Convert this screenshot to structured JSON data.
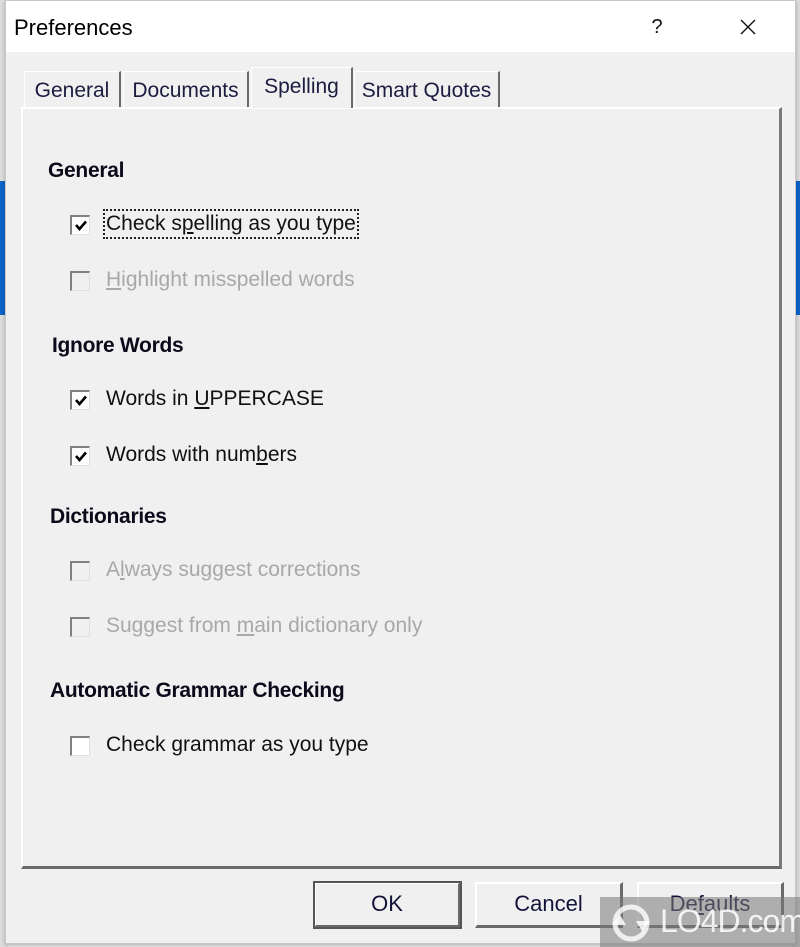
{
  "window": {
    "title": "Preferences",
    "help_label": "?",
    "close_icon": "close-icon"
  },
  "tabs": [
    {
      "label": "General",
      "active": false
    },
    {
      "label": "Documents",
      "active": false
    },
    {
      "label": "Spelling",
      "active": true
    },
    {
      "label": "Smart Quotes",
      "active": false
    }
  ],
  "sections": {
    "general": {
      "title": "General",
      "options": [
        {
          "label_pre": "Check s",
          "mnemonic": "p",
          "label_post": "elling as you type",
          "checked": true,
          "enabled": true,
          "focused": true
        },
        {
          "label_pre": "",
          "mnemonic": "H",
          "label_post": "ighlight misspelled words",
          "checked": false,
          "enabled": false
        }
      ]
    },
    "ignore_words": {
      "title": "Ignore Words",
      "options": [
        {
          "label_pre": "Words in ",
          "mnemonic": "U",
          "label_post": "PPERCASE",
          "checked": true,
          "enabled": true
        },
        {
          "label_pre": "Words with num",
          "mnemonic": "b",
          "label_post": "ers",
          "checked": true,
          "enabled": true
        }
      ]
    },
    "dictionaries": {
      "title": "Dictionaries",
      "options": [
        {
          "label_pre": "A",
          "mnemonic": "l",
          "label_post": "ways suggest corrections",
          "checked": false,
          "enabled": false
        },
        {
          "label_pre": "Suggest from ",
          "mnemonic": "m",
          "label_post": "ain dictionary only",
          "checked": false,
          "enabled": false
        }
      ]
    },
    "grammar": {
      "title": "Automatic Grammar Checking",
      "options": [
        {
          "label_pre": "Check ",
          "mnemonic": "g",
          "label_post": "rammar as you type",
          "checked": false,
          "enabled": true
        }
      ]
    }
  },
  "buttons": {
    "ok": "OK",
    "cancel": "Cancel",
    "defaults_pre": "De",
    "defaults_mnemonic": "f",
    "defaults_post": "aults"
  },
  "watermark": {
    "text": "LO4D.com"
  }
}
